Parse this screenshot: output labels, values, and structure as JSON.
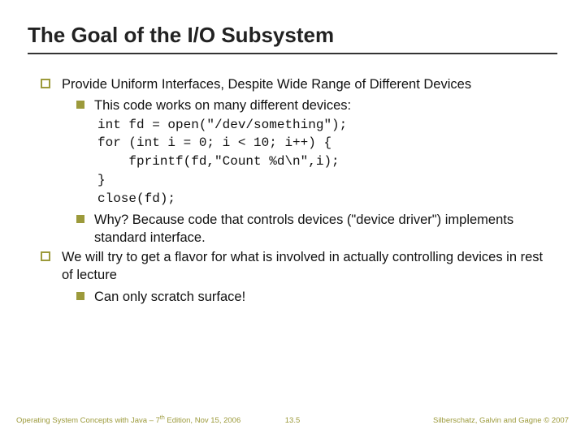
{
  "title": "The Goal of the I/O Subsystem",
  "b1": {
    "text": "Provide Uniform Interfaces, Despite Wide Range of Different Devices",
    "sub1": "This code works on many different devices:",
    "code1": "int fd = open(\"/dev/something\");",
    "code2": "for (int i = 0; i < 10; i++) {",
    "code3": "    fprintf(fd,\"Count %d\\n\",i);",
    "code4": "}",
    "code5": "close(fd);",
    "sub2": "Why? Because code that controls devices (\"device driver\") implements standard interface."
  },
  "b2": {
    "text": "We will try to get a flavor for what is involved in actually controlling devices in rest of lecture",
    "sub1": "Can only scratch surface!"
  },
  "footer": {
    "left_a": "Operating System Concepts with Java – 7",
    "left_sup": "th",
    "left_b": " Edition, Nov 15, 2006",
    "center": "13.5",
    "right": "Silberschatz, Galvin and Gagne © 2007"
  }
}
